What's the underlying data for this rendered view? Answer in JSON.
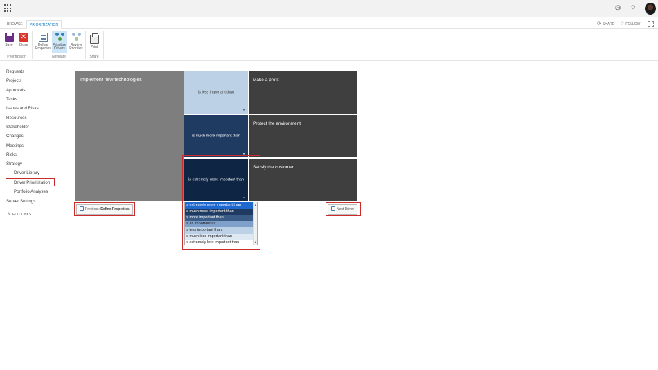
{
  "suitebar": {
    "settings_icon": "gear-icon",
    "help_label": "?",
    "avatar_icon": "user-avatar"
  },
  "ribbon_tabs": [
    {
      "label": "BROWSE"
    },
    {
      "label": "PRIORITIZATION",
      "active": true
    }
  ],
  "actions": {
    "share_label": "SHARE",
    "follow_label": "FOLLOW"
  },
  "ribbon": {
    "buttons": [
      {
        "label": "Save",
        "icon": "save-icon"
      },
      {
        "label": "Close",
        "icon": "close-icon",
        "glyph": "✕"
      },
      {
        "label_line1": "Define",
        "label_line2": "Properties",
        "icon": "define-properties-icon"
      },
      {
        "label_line1": "Prioritize",
        "label_line2": "Drivers",
        "icon": "prioritize-drivers-icon",
        "selected": true
      },
      {
        "label_line1": "Review",
        "label_line2": "Priorities",
        "icon": "review-priorities-icon"
      },
      {
        "label": "Print",
        "icon": "print-icon"
      }
    ],
    "groups": [
      "Prioritization",
      "Navigate",
      "Share"
    ]
  },
  "quicklaunch": {
    "items": [
      "Requests",
      "Projects",
      "Approvals",
      "Tasks",
      "Issues and Risks",
      "Resources",
      "Stakeholder",
      "Changes",
      "Meetings",
      "Risks",
      "Strategy"
    ],
    "sub_items": [
      "Driver Library",
      "Driver Prioritization",
      "Portfolio Analyses"
    ],
    "after": [
      "Server Settings"
    ],
    "edit_links": "EDIT LINKS",
    "selected": "Driver Prioritization"
  },
  "matrix": {
    "left_driver": "Implement new technologies",
    "rows": [
      {
        "comparison": "is less important than",
        "driver": "Make a profit",
        "color": "#bcd0e6"
      },
      {
        "comparison": "is much more important than",
        "driver": "Protect the environment",
        "color": "#203b61"
      },
      {
        "comparison": "is extremely more important than",
        "driver": "Satisfy the customer",
        "color": "#0f2544"
      }
    ],
    "arrow_glyph": "▼"
  },
  "nav": {
    "previous_prefix": "Previous:",
    "previous_target": "Define Properties",
    "next_label": "Next Driver"
  },
  "dropdown": {
    "options": [
      "is extremely more important than",
      "is much more important than",
      "is more important than",
      "is as important as",
      "is less important than",
      "is much less important than",
      "is extremely less important than"
    ],
    "selected": "is extremely more important than",
    "scroll_up": "▲",
    "scroll_down": "▼"
  }
}
